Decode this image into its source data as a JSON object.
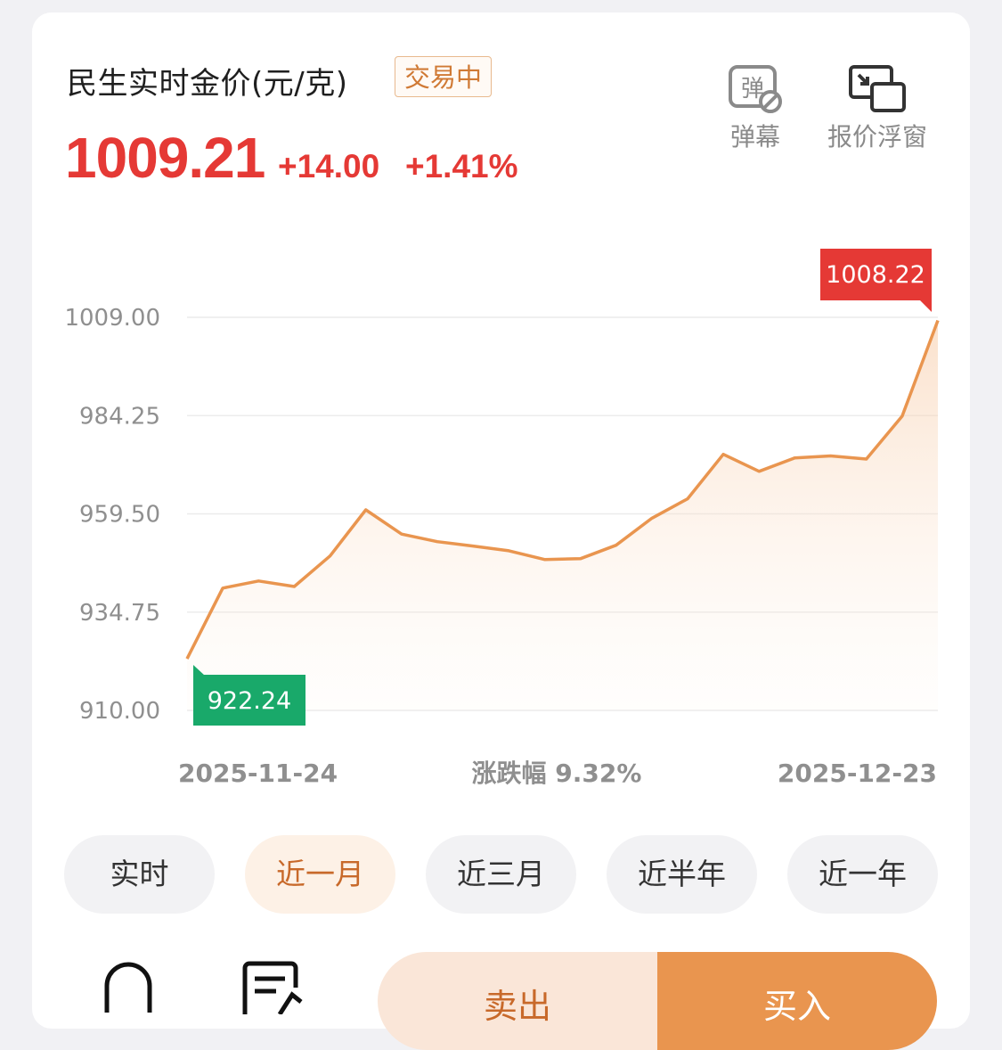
{
  "header": {
    "title": "民生实时金价(元/克)",
    "status": "交易中",
    "price": "1009.21",
    "change": "+14.00",
    "change_pct": "+1.41%"
  },
  "tools": [
    {
      "label": "弹幕",
      "icon": "danmaku-icon"
    },
    {
      "label": "报价浮窗",
      "icon": "floating-window-icon"
    }
  ],
  "chart_data": {
    "type": "area",
    "title": "",
    "xlabel": "",
    "ylabel": "",
    "y_ticks": [
      "1009.00",
      "984.25",
      "959.50",
      "934.75",
      "910.00"
    ],
    "ylim": [
      910.0,
      1009.0
    ],
    "x_start_label": "2025-11-24",
    "x_end_label": "2025-12-23",
    "center_label": "涨跌幅 9.32%",
    "min_label": "922.24",
    "max_label": "1008.22",
    "series": [
      {
        "values": [
          923.0,
          940.8,
          942.6,
          941.2,
          948.9,
          960.5,
          954.4,
          952.5,
          951.4,
          950.2,
          948.0,
          948.2,
          951.6,
          958.4,
          963.3,
          974.5,
          970.2,
          973.6,
          974.1,
          973.3,
          984.1,
          1008.22
        ]
      }
    ],
    "colors": {
      "line": "#e9954f",
      "max_tag": "#e53935",
      "min_tag": "#19a96a"
    },
    "grid": true
  },
  "tabs": [
    {
      "label": "实时",
      "active": false
    },
    {
      "label": "近一月",
      "active": true
    },
    {
      "label": "近三月",
      "active": false
    },
    {
      "label": "近半年",
      "active": false
    },
    {
      "label": "近一年",
      "active": false
    }
  ],
  "bottom": {
    "icons": [
      "bell-icon",
      "order-record-icon"
    ],
    "sell_label": "卖出",
    "buy_label": "买入"
  }
}
